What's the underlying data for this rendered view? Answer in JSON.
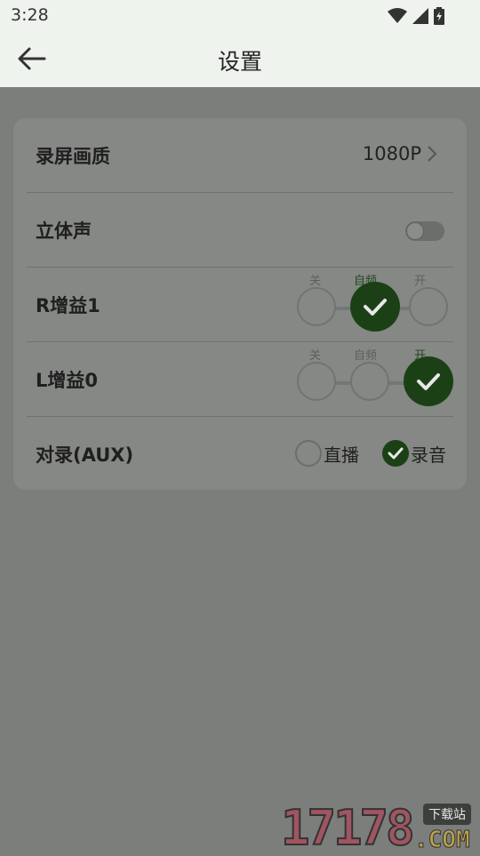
{
  "status_bar": {
    "time": "3:28",
    "icons": [
      "wifi-icon",
      "signal-icon",
      "battery-charging-icon"
    ]
  },
  "app_bar": {
    "title": "设置",
    "back_icon": "arrow-left-icon"
  },
  "settings": {
    "quality": {
      "label": "录屏画质",
      "value": "1080P"
    },
    "stereo": {
      "label": "立体声",
      "enabled": false
    },
    "r_gain": {
      "label": "R增益1",
      "options": [
        "关",
        "自频",
        "开"
      ],
      "selected_index": 1
    },
    "l_gain": {
      "label": "L增益0",
      "options": [
        "关",
        "自频",
        "开"
      ],
      "selected_index": 2
    },
    "aux": {
      "label": "对录(AUX)",
      "options": [
        "直播",
        "录音"
      ],
      "selected": "录音"
    }
  },
  "watermark": {
    "digits": "17178",
    "domain": ".COM",
    "badge": "下载站"
  },
  "colors": {
    "accent": "#1b4016",
    "overlay": "#7b7e7b",
    "app_bar": "#eef3ee"
  }
}
